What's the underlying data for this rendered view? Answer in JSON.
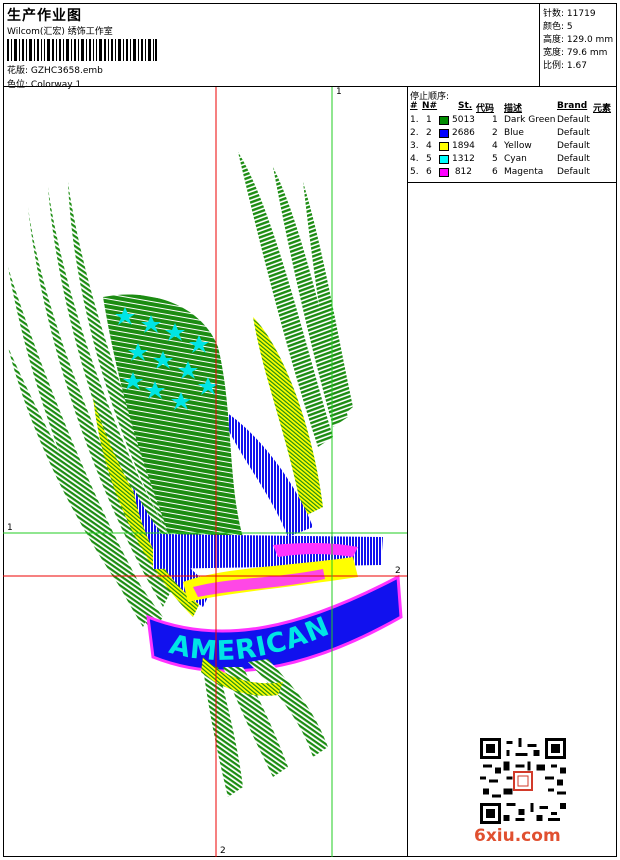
{
  "header": {
    "title": "生产作业图",
    "company": "Wilcom(汇宏) 绣饰工作室",
    "design_label": "花版:",
    "design_value": "GZHC3658.emb",
    "colorway_label": "色位:",
    "colorway_value": "Colorway 1"
  },
  "stats": [
    {
      "label": "针数:",
      "value": "11719"
    },
    {
      "label": "颜色:",
      "value": "5"
    },
    {
      "label": "高度:",
      "value": "129.0 mm"
    },
    {
      "label": "宽度:",
      "value": "79.6 mm"
    },
    {
      "label": "比例:",
      "value": "1.67"
    }
  ],
  "stop_sequence": {
    "title": "停止顺序:",
    "headers": {
      "hash": "#",
      "n": "N#",
      "st": "St.",
      "code": "代码",
      "desc": "描述",
      "brand": "Brand",
      "element": "元素"
    },
    "rows": [
      {
        "hash": "1.",
        "n": "1",
        "color": "#008c00",
        "st": "5013",
        "code": "1",
        "desc": "Dark Green",
        "brand": "Default"
      },
      {
        "hash": "2.",
        "n": "2",
        "color": "#0000ff",
        "st": "2686",
        "code": "2",
        "desc": "Blue",
        "brand": "Default"
      },
      {
        "hash": "3.",
        "n": "4",
        "color": "#ffff00",
        "st": "1894",
        "code": "4",
        "desc": "Yellow",
        "brand": "Default"
      },
      {
        "hash": "4.",
        "n": "5",
        "color": "#00ffff",
        "st": "1312",
        "code": "5",
        "desc": "Cyan",
        "brand": "Default"
      },
      {
        "hash": "5.",
        "n": "6",
        "color": "#ff00ff",
        "st": "812",
        "code": "6",
        "desc": "Magenta",
        "brand": "Default"
      }
    ]
  },
  "guides": {
    "v1": "1",
    "h1": "1",
    "h2": "2",
    "v2": "2"
  },
  "artwork_text": "AMERICAN",
  "watermark": "6xiu.com"
}
